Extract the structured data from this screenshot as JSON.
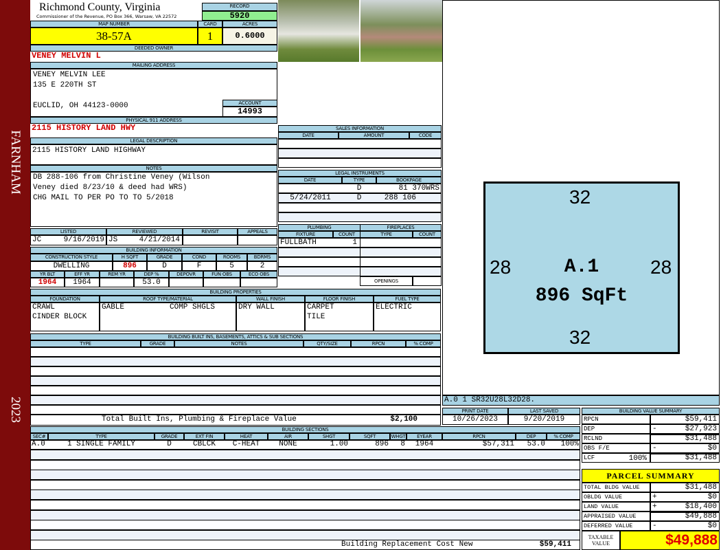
{
  "sidebar": {
    "district": "FARNHAM",
    "year": "2023"
  },
  "header": {
    "title": "Richmond County, Virginia",
    "subtitle": "Commissioner of the Revenue, PO Box 366, Warsaw, VA 22572",
    "record_label": "RECORD",
    "record": "5920",
    "map_label": "MAP NUMBER",
    "map": "38-57A",
    "card_label": "CARD",
    "card": "1",
    "acres_label": "ACRES",
    "acres": "0.6000"
  },
  "owner": {
    "label": "DEEDED OWNER",
    "name": "VENEY MELVIN L"
  },
  "mailing": {
    "label": "MAILING ADDRESS",
    "lines": [
      "VENEY MELVIN LEE",
      "135 E 220TH ST",
      "EUCLID, OH 44123-0000"
    ],
    "account_label": "ACCOUNT",
    "account": "14993"
  },
  "address": {
    "label": "PHYSICAL 911 ADDRESS",
    "value": "2115 HISTORY LAND HWY"
  },
  "legal": {
    "label": "LEGAL DESCRIPTION",
    "value": "2115 HISTORY LAND HIGHWAY"
  },
  "notes": {
    "label": "NOTES",
    "lines": [
      "DB 288-106 from Christine Veney (Wilson",
      "Veney died 8/23/10 & deed had WRS)",
      "CHG MAIL TO PER PO TO TO 5/2018"
    ]
  },
  "listing": {
    "listed_label": "LISTED",
    "reviewed_label": "REVIEWED",
    "revisit_label": "REVISIT",
    "appeals_label": "APPEALS",
    "listed_by": "JC",
    "listed_date": "9/16/2019",
    "reviewed_by": "JS",
    "reviewed_date": "4/21/2014"
  },
  "building": {
    "label": "BUILDING INFORMATION",
    "heads": [
      "CONSTRUCTION STYLE",
      "H SQFT",
      "GRADE",
      "COND",
      "ROOMS",
      "BDRMS"
    ],
    "vals": [
      "DWELLING",
      "896",
      "D",
      "F",
      "5",
      "2"
    ],
    "heads2": [
      "YR BLT",
      "EFF YR",
      "REM YR",
      "DEP %",
      "DEPOVR",
      "FUN OBS",
      "ECO OBS"
    ],
    "vals2": [
      "1964",
      "1964",
      "",
      "53.0",
      "",
      "",
      ""
    ]
  },
  "props": {
    "label": "BUILDING PROPERTIES",
    "heads": [
      "FOUNDATION",
      "ROOF TYPE/MATERIAL",
      "WALL FINISH",
      "FLOOR FINISH",
      "FUEL TYPE"
    ],
    "foundation": [
      "CRAWL",
      "CINDER BLOCK"
    ],
    "roof_type": "GABLE",
    "roof_material": "COMP SHGLS",
    "wall": "DRY WALL",
    "floor": [
      "CARPET",
      "TILE"
    ],
    "fuel": "ELECTRIC"
  },
  "builtins": {
    "label": "BUILDING BUILT INS, BASEMENTS, ATTICS & SUB SECTIONS",
    "heads": [
      "TYPE",
      "GRADE",
      "NOTES",
      "QTY/SIZE",
      "RPCN",
      "% COMP"
    ],
    "total_label": "Total Built Ins, Plumbing & Fireplace Value",
    "total": "$2,100"
  },
  "sales": {
    "label": "SALES INFORMATION",
    "heads": [
      "DATE",
      "AMOUNT",
      "CODE"
    ]
  },
  "instruments": {
    "label": "LEGAL INSTRUMENTS",
    "heads": [
      "DATE",
      "TYPE",
      "BOOKPAGE"
    ],
    "rows": [
      [
        "",
        "D",
        "81 370WRS"
      ],
      [
        "5/24/2011",
        "D",
        "288 106"
      ]
    ]
  },
  "plumbing": {
    "label": "PLUMBING",
    "heads": [
      "FIXTURE",
      "COUNT"
    ],
    "rows": [
      [
        "FULLBATH",
        "1"
      ]
    ]
  },
  "fireplaces": {
    "label": "FIREPLACES",
    "heads": [
      "TYPE",
      "COUNT"
    ],
    "openings_label": "OPENINGS"
  },
  "sketch": {
    "top": "32",
    "bottom": "32",
    "left": "28",
    "right": "28",
    "code": "A.1",
    "area": "896 SqFt",
    "vector": "A.0   1    SR32U28L32D28."
  },
  "dates": {
    "print_label": "PRINT DATE",
    "print": "10/26/2023",
    "saved_label": "LAST SAVED",
    "saved": "9/20/2019"
  },
  "sections": {
    "label": "BUILDING SECTIONS",
    "heads": [
      "SEC#",
      "TYPE",
      "GRADE",
      "EXT FIN",
      "HEAT",
      "AIR",
      "SHGT",
      "SQFT",
      "WHGT",
      "EYEAR",
      "RPCN",
      "DEP",
      "% COMP"
    ],
    "row": [
      "A.0",
      "1 SINGLE FAMILY",
      "D",
      "CBLCK",
      "C-HEAT",
      "NONE",
      "1.00",
      "896",
      "8",
      "1964",
      "$57,311",
      "53.0",
      "100%"
    ],
    "replacement_label": "Building Replacement Cost New",
    "replacement": "$59,411"
  },
  "value_summary": {
    "label": "BUILDING VALUE SUMMARY",
    "rows": [
      {
        "l": "RPCN",
        "s": "",
        "v": "$59,411"
      },
      {
        "l": "DEP",
        "s": "-",
        "v": "$27,923"
      },
      {
        "l": "RCLND",
        "s": "",
        "v": "$31,488"
      },
      {
        "l": "OBS F/E",
        "s": "-",
        "v": "$0"
      },
      {
        "l": "LCF",
        "p": "100%",
        "s": "",
        "v": "$31,488"
      }
    ]
  },
  "parcel": {
    "label": "PARCEL SUMMARY",
    "rows": [
      {
        "l": "TOTAL BLDG VALUE",
        "s": "",
        "v": "$31,488"
      },
      {
        "l": "OBLDG VALUE",
        "s": "+",
        "v": "$0"
      },
      {
        "l": "LAND VALUE",
        "s": "+",
        "v": "$18,400"
      },
      {
        "l": "APPRAISED VALUE",
        "s": "",
        "v": "$49,888"
      },
      {
        "l": "DEFERRED VALUE",
        "s": "-",
        "v": "$0"
      }
    ],
    "taxable_label": "TAXABLE VALUE",
    "taxable": "$49,888"
  },
  "colors": {
    "sidebar": "#7d0b0b",
    "header": "#a9d3e4",
    "record": "#90ee90",
    "highlight": "#ffff00",
    "sketch": "#add8e6",
    "emphasis": "#d00000"
  }
}
